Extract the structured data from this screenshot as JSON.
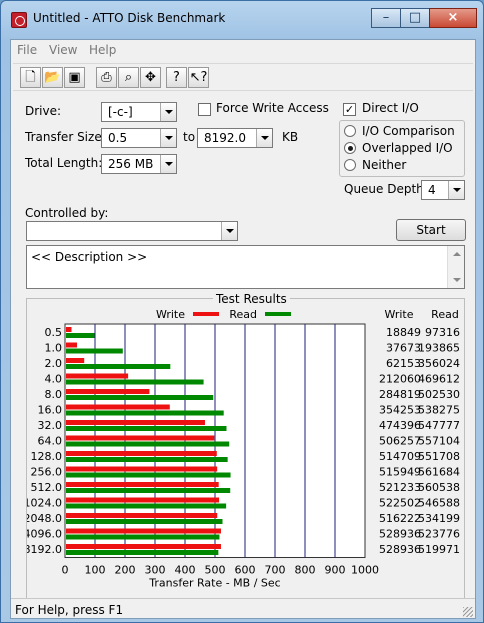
{
  "window": {
    "title": "Untitled - ATTO Disk Benchmark",
    "minimize_icon": "minimize-icon",
    "maximize_icon": "maximize-icon",
    "close_icon": "close-icon"
  },
  "menu": [
    {
      "label": "File"
    },
    {
      "label": "View"
    },
    {
      "label": "Help"
    }
  ],
  "toolbar": [
    "new-file-icon",
    "open-folder-icon",
    "save-icon",
    "print-icon",
    "print-preview-icon",
    "move-icon",
    "help-icon",
    "context-help-icon"
  ],
  "form": {
    "drive_label": "Drive:",
    "drive_value": "[-c-]",
    "transfer_size_label": "Transfer Size:",
    "transfer_from": "0.5",
    "to_label": "to",
    "transfer_to": "8192.0",
    "kb_label": "KB",
    "total_length_label": "Total Length:",
    "total_length_value": "256 MB",
    "force_write_access": "Force Write Access",
    "direct_io": "Direct I/O",
    "io_comparison": "I/O Comparison",
    "overlapped_io": "Overlapped I/O",
    "neither": "Neither",
    "queue_depth_label": "Queue Depth:",
    "queue_depth_value": "4",
    "controlled_by_label": "Controlled by:",
    "controlled_by_value": "",
    "start_button": "Start",
    "description": "<< Description >>"
  },
  "results": {
    "title": "Test Results",
    "write_label": "Write",
    "read_label": "Read",
    "write_color": "#ee1111",
    "read_color": "#008800"
  },
  "chart_data": {
    "type": "bar",
    "orientation": "horizontal",
    "categories": [
      "0.5",
      "1.0",
      "2.0",
      "4.0",
      "8.0",
      "16.0",
      "32.0",
      "64.0",
      "128.0",
      "256.0",
      "512.0",
      "1024.0",
      "2048.0",
      "4096.0",
      "8192.0"
    ],
    "series": [
      {
        "name": "Write",
        "values": [
          18849,
          37673,
          62153,
          212060,
          284819,
          354253,
          474396,
          506257,
          514709,
          515949,
          521233,
          522502,
          516222,
          528936,
          528936
        ]
      },
      {
        "name": "Read",
        "values": [
          97316,
          193865,
          356024,
          469612,
          502530,
          538275,
          547777,
          557104,
          551708,
          561684,
          560538,
          546588,
          534199,
          523776,
          519971
        ]
      }
    ],
    "xlabel": "Transfer Rate - MB / Sec",
    "xticks": [
      0,
      100,
      200,
      300,
      400,
      500,
      600,
      700,
      800,
      900,
      1000
    ],
    "xlim": [
      0,
      1000
    ],
    "grid": true
  },
  "statusbar": {
    "text": "For Help, press F1"
  }
}
